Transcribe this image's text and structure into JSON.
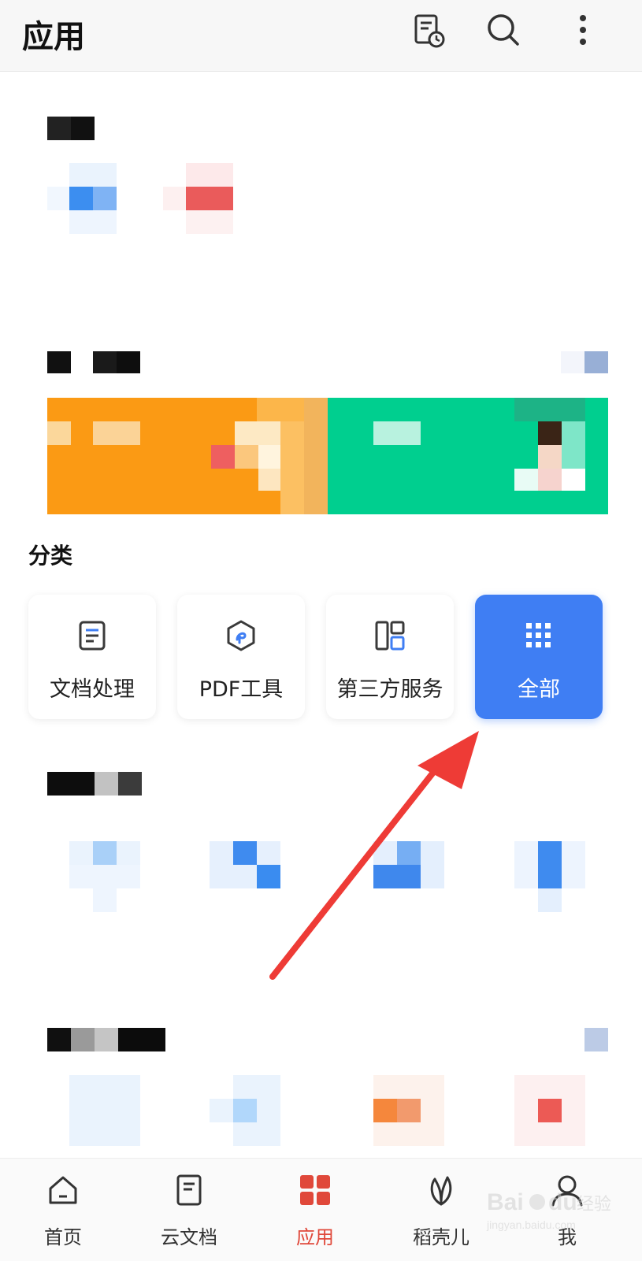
{
  "header": {
    "title": "应用",
    "icons": [
      "recent-files-icon",
      "search-icon",
      "more-options-icon"
    ]
  },
  "categories": {
    "title": "分类",
    "items": [
      {
        "label": "文档处理",
        "icon": "document-icon",
        "active": false
      },
      {
        "label": "PDF工具",
        "icon": "pdf-icon",
        "active": false
      },
      {
        "label": "第三方服务",
        "icon": "grid-layout-icon",
        "active": false
      },
      {
        "label": "全部",
        "icon": "all-apps-icon",
        "active": true
      }
    ]
  },
  "bottom_nav": {
    "items": [
      {
        "label": "首页",
        "icon": "home-icon",
        "active": false
      },
      {
        "label": "云文档",
        "icon": "cloud-doc-icon",
        "active": false
      },
      {
        "label": "应用",
        "icon": "apps-icon",
        "active": true
      },
      {
        "label": "稻壳儿",
        "icon": "leaf-icon",
        "active": false
      },
      {
        "label": "我",
        "icon": "profile-icon",
        "active": false
      }
    ]
  },
  "colors": {
    "accent_blue": "#3f7ef3",
    "active_red": "#e0483a",
    "annotation_arrow": "#ee3b36",
    "banner_orange": "#fb9a14",
    "banner_green": "#00cf8f"
  },
  "watermark": {
    "brand": "Bai",
    "brand2": "du",
    "suffix": "经验",
    "url": "jingyan.baidu.com"
  }
}
